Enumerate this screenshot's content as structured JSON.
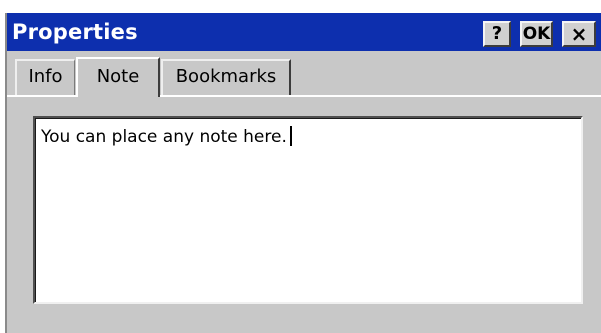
{
  "window": {
    "title": "Properties",
    "help_label": "?",
    "ok_label": "OK",
    "close_label": "×"
  },
  "tabs": [
    {
      "label": "Info",
      "active": false
    },
    {
      "label": "Note",
      "active": true
    },
    {
      "label": "Bookmarks",
      "active": false
    }
  ],
  "note": {
    "text": "You can place any note here."
  },
  "colors": {
    "titlebar": "#0d2fae",
    "face": "#c8c8c8",
    "field": "#ffffff"
  }
}
